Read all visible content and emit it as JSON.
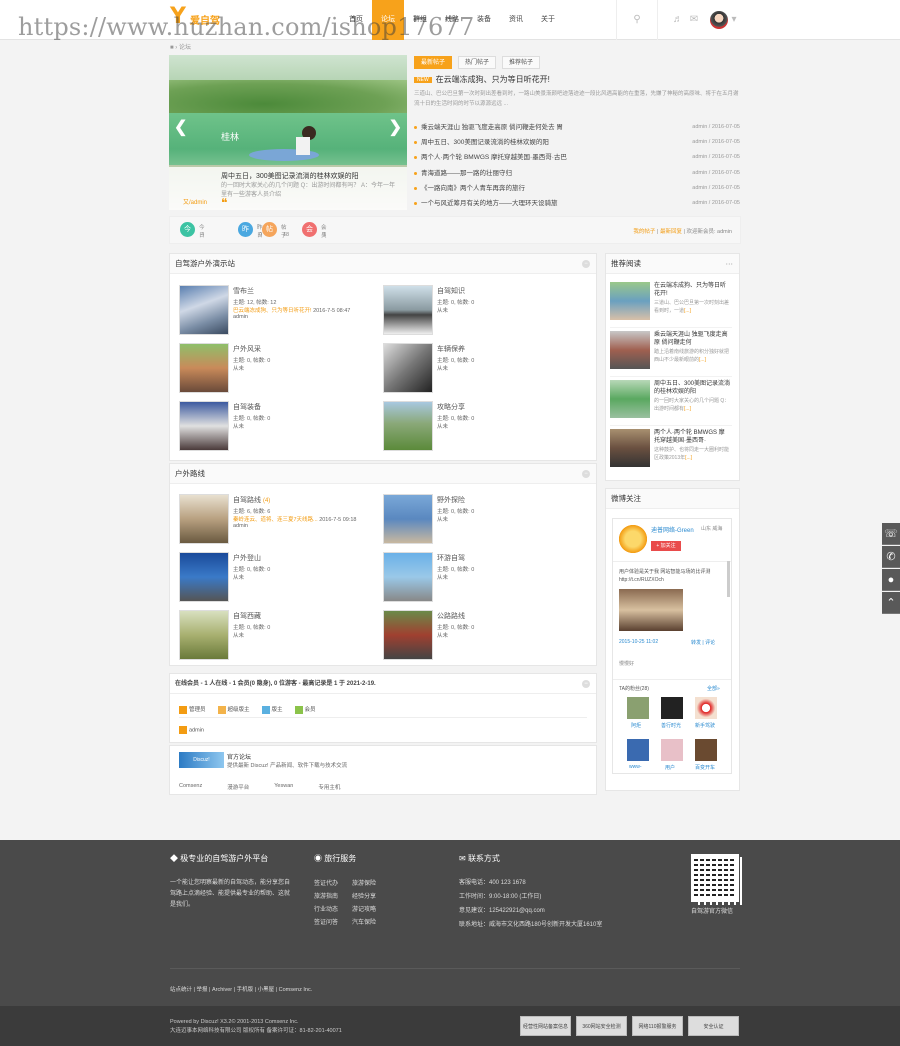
{
  "watermark": "https://www.huzhan.com/ishop17677",
  "logo": {
    "text": "爱自驾"
  },
  "nav": [
    "首页",
    "论坛",
    "群组",
    "线路",
    "装备",
    "资讯",
    "关于"
  ],
  "nav_active": 1,
  "breadcrumb": "论坛",
  "slider": {
    "title": "周中五日，300美图记录流淌的桂林欢娱的阳",
    "desc": "的一回时大家关心的几个问题 Q：出游时间都有吗？ A：今年一年里有一些游客人员介绍",
    "author": "又/admin",
    "caption_title": "桂林"
  },
  "tabs": [
    "最新帖子",
    "热门帖子",
    "推荐帖子"
  ],
  "headline": {
    "badge": "NEW",
    "title": "在云端冻成狗、只为等日听花开!",
    "desc": "三道山、巴公巴旦第一次时刻出差看到时，一路山美景渐颜吧迹落迹迹一段比风遇高能的在重落，先嫌了神秘的高原味、将于在五月谢流十日的生活时间的时节以源源远远 ..."
  },
  "news": [
    {
      "t": "乘云端天涯山 独驱飞度走高原 倘问鞭走何处去 胃",
      "d": "admin / 2016-07-05"
    },
    {
      "t": "周中五日、300美图记录流淌的桂林欢娱的阳",
      "d": "admin / 2016-07-05"
    },
    {
      "t": "两个人·两个轮 BMWGS 摩托穿越美国·墨西哥·古巴",
      "d": "admin / 2016-07-05"
    },
    {
      "t": "青海道路——那一路的壮丽守归",
      "d": "admin / 2016-07-05"
    },
    {
      "t": "《一路向南》两个人青车再奔的旅行",
      "d": "admin / 2016-07-05"
    },
    {
      "t": "一个与风近筹月有关的地方——大理环天设骑旅",
      "d": "admin / 2016-07-05"
    }
  ],
  "stats": [
    {
      "icon": "今",
      "label": "今日",
      "value": "4"
    },
    {
      "icon": "昨",
      "label": "昨日",
      "value": "0"
    },
    {
      "icon": "帖",
      "label": "帖子",
      "value": "18"
    },
    {
      "icon": "会",
      "label": "会员",
      "value": "1"
    }
  ],
  "stats_right": {
    "a": "我的帖子",
    "b": "最新回复",
    "c": "欢迎新会员: admin"
  },
  "section1": {
    "title": "自驾游户外演示站",
    "forums": [
      {
        "name": "雪布兰",
        "m1": "主题: 12, 帖数: 12",
        "m2": "巴云端冻成狗、只为等日听花开!",
        "m2b": "2016-7-5 08:47",
        "m3": "admin"
      },
      {
        "name": "自驾知识",
        "m1": "主题: 0, 帖数: 0",
        "m2": "从未",
        "m3": ""
      },
      {
        "name": "户外风采",
        "m1": "主题: 0, 帖数: 0",
        "m2": "从未",
        "m3": ""
      },
      {
        "name": "车辆保养",
        "m1": "主题: 0, 帖数: 0",
        "m2": "从未",
        "m3": ""
      },
      {
        "name": "自驾装备",
        "m1": "主题: 0, 帖数: 0",
        "m2": "从未",
        "m3": ""
      },
      {
        "name": "攻略分享",
        "m1": "主题: 0, 帖数: 0",
        "m2": "从未",
        "m3": ""
      }
    ]
  },
  "section2": {
    "title": "户外路线",
    "forums": [
      {
        "name": "自驾路线",
        "badge": "(4)",
        "m1": "主题: 6, 帖数: 6",
        "m2": "秦岭连云、道将、连三夏7天线路...",
        "m2b": "2016-7-5 09:18",
        "m3": "admin"
      },
      {
        "name": "野外探险",
        "m1": "主题: 0, 帖数: 0",
        "m2": "从未",
        "m3": ""
      },
      {
        "name": "户外登山",
        "m1": "主题: 0, 帖数: 0",
        "m2": "从未",
        "m3": ""
      },
      {
        "name": "环游自驾",
        "m1": "主题: 0, 帖数: 0",
        "m2": "从未",
        "m3": ""
      },
      {
        "name": "自驾西藏",
        "m1": "主题: 0, 帖数: 0",
        "m2": "从未",
        "m3": ""
      },
      {
        "name": "公路路线",
        "m1": "主题: 0, 帖数: 0",
        "m2": "从未",
        "m3": ""
      }
    ]
  },
  "online": {
    "title": "在线会员 - 1 人在线 - 1 会员(0 隐身), 0 位游客 - 最高记录是 1 于 2021-2-19.",
    "legend": [
      "管理员",
      "超级版主",
      "版主",
      "会员"
    ],
    "users": [
      "admin"
    ]
  },
  "partner": {
    "name": "官方论坛",
    "desc": "提供最新 Discuz! 产品新闻、软件下载与技术交流",
    "links": [
      "Comsenz",
      "漫游平台",
      "Yeswan",
      "专用主机"
    ]
  },
  "rec": {
    "title": "推荐阅读",
    "items": [
      {
        "t": "在云端冻成狗、只为等日听花开!",
        "d": "三道山、巴公巴旦第一次时刻出差看到时，一道"
      },
      {
        "t": "乘云端天涯山 独驱飞度走高原 倘问鞭走何",
        "d": "踏上沿着南线旅游的积分独好就把西山不少最新眼前的"
      },
      {
        "t": "周中五日、300美图记录流淌的桂林欢娱的阳",
        "d": "的一回时大家关心的几个问题 Q：出游时间都有"
      },
      {
        "t": "两个人·两个轮 BMWGS 摩托穿越美国·墨西哥·",
        "d": "这种鼓护、也将同走一大圈利时能区政策2013年"
      }
    ]
  },
  "weibo": {
    "title": "微博关注",
    "name": "迪普网络-Green",
    "loc": "山东 威海",
    "follow": "+ 加关注",
    "post": "用户体验是关于我 网站智能马场的比评测 http://t.cn/RUZXOch",
    "date": "2015-10-25 11:02",
    "fw": "转发",
    "cm": "评论",
    "fans_label": "TA的粉丝(28)",
    "all": "全部»",
    "fans": [
      "阿炬",
      "善行时光",
      "新手驾驶",
      "www-",
      "用户",
      "百变开车"
    ],
    "more": "慢慢好"
  },
  "footer": {
    "about_title": "极专业的自驾游户外平台",
    "about": "一个能让您明察最新的自驾动态，能分享您自驾路上点滴经验、能提供最专业的帮助、这就是我们。",
    "svc_title": "旅行服务",
    "svc": [
      "签证代办",
      "旅游保险",
      "旅游指南",
      "经验分享",
      "行业动态",
      "游记攻略",
      "签证问答",
      "汽车保险"
    ],
    "contact_title": "联系方式",
    "contact": [
      "客服电话：400 123 1678",
      "工作时间：9:00-18:00 (工作日)",
      "意见建议：125422921@qq.com",
      "联系地址：威海市文化西路180号创新开发大厦1610室"
    ],
    "qr_label": "自驾游官方微信",
    "links": "站点统计 | 举报 | Archiver | 手机版 | 小黑屋 | Comsenz Inc.",
    "copy1": "Powered by Discuz! X3.2© 2001-2013 Comsenz Inc.",
    "copy2": "大连迈事本网络科技有限公司 版权所有    备案许可证：81-82-201-40071",
    "badges": [
      "经营性网站备案信息",
      "360网站安全检测",
      "网络110报警服务",
      "安全认证"
    ]
  }
}
